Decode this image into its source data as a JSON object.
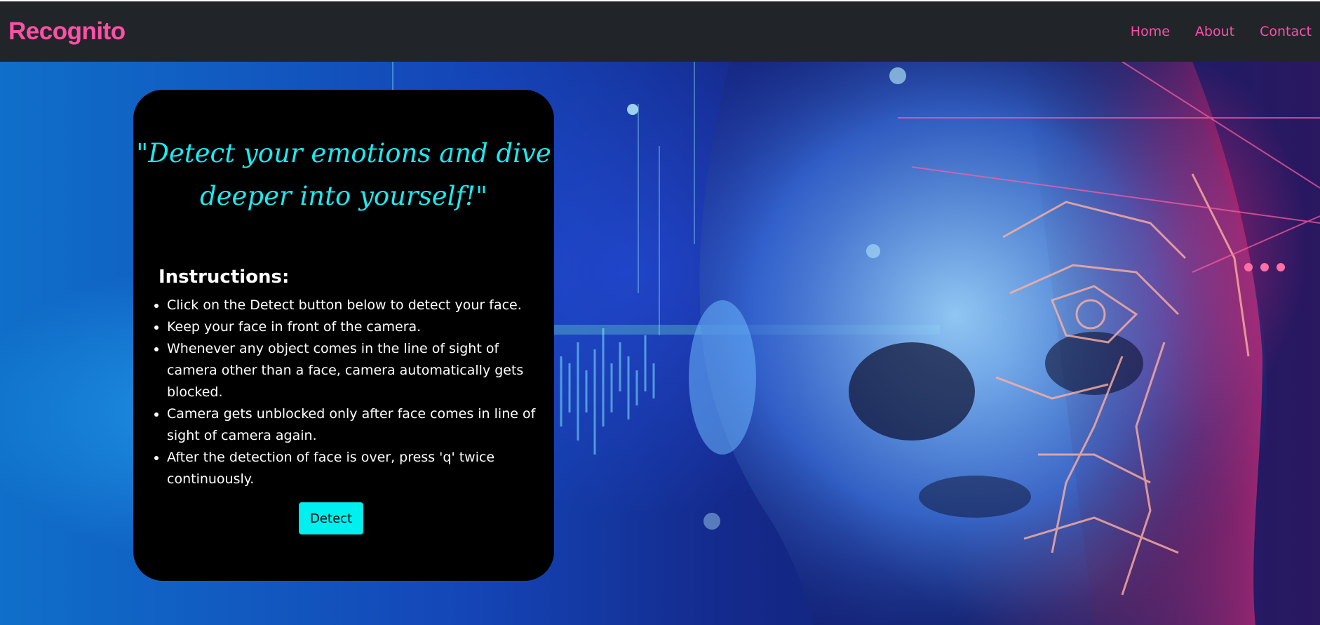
{
  "navbar": {
    "brand": "Recognito",
    "links": [
      "Home",
      "About",
      "Contact"
    ]
  },
  "card": {
    "quote": "\"Detect your emotions and dive deeper into yourself!\"",
    "instructions_title": "Instructions:",
    "instructions": [
      "Click on the Detect button below to detect your face.",
      "Keep your face in front of the camera.",
      "Whenever any object comes in the line of sight of camera other than a face, camera automatically gets blocked.",
      "Camera gets unblocked only after face comes in line of sight of camera again.",
      "After the detection of face is over, press 'q' twice continuously."
    ],
    "button_label": "Detect"
  },
  "colors": {
    "navbar_bg": "#212529",
    "accent_pink": "#ff4fa7",
    "quote_cyan": "#1de9f0",
    "button_cyan": "#00f0f0",
    "card_bg": "#000000"
  },
  "background_image": "ai-face-hero-image"
}
